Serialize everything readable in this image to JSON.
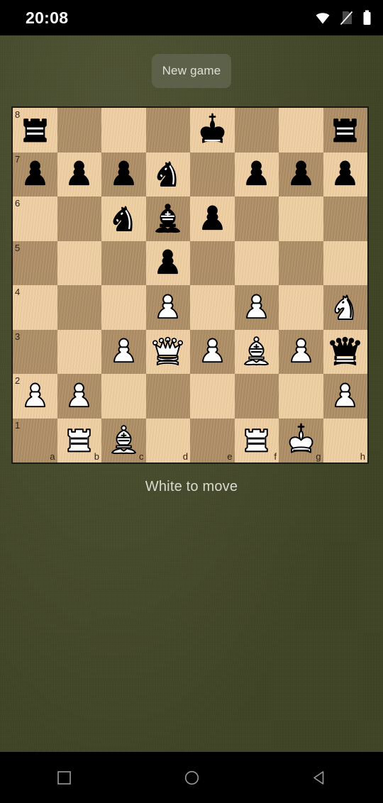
{
  "status_bar": {
    "clock": "20:08",
    "icons": [
      "wifi-icon",
      "no-sim-icon",
      "battery-icon"
    ]
  },
  "toolbar": {
    "new_game_label": "New game"
  },
  "board": {
    "files": [
      "a",
      "b",
      "c",
      "d",
      "e",
      "f",
      "g",
      "h"
    ],
    "ranks": [
      "8",
      "7",
      "6",
      "5",
      "4",
      "3",
      "2",
      "1"
    ],
    "light_square_color": "#edcda1",
    "dark_square_color": "#ab8c65",
    "orientation": "white-bottom",
    "position": [
      [
        "br",
        "",
        "",
        "",
        "bk",
        "",
        "",
        "br"
      ],
      [
        "bp",
        "bp",
        "bp",
        "bn",
        "",
        "bp",
        "bp",
        "bp"
      ],
      [
        "",
        "",
        "bn",
        "bb",
        "bp",
        "",
        "",
        ""
      ],
      [
        "",
        "",
        "",
        "bp",
        "",
        "",
        "",
        ""
      ],
      [
        "",
        "",
        "",
        "wp",
        "",
        "wp",
        "",
        "wn"
      ],
      [
        "",
        "",
        "wp",
        "wq",
        "wp",
        "wb",
        "wp",
        "bq"
      ],
      [
        "wp",
        "wp",
        "",
        "",
        "",
        "",
        "",
        "wp"
      ],
      [
        "",
        "wr",
        "wb",
        "",
        "",
        "wr",
        "wk",
        ""
      ]
    ],
    "fen": "r3k2r/pppn1ppp/2nbp3/3p4/3P1P1N/2PQPBPq/PP5P/1RB2RK1 w kq - 0 1"
  },
  "status": {
    "text": "White to move"
  },
  "nav_bar": {
    "recents_label": "recents-square-icon",
    "home_label": "home-circle-icon",
    "back_label": "back-triangle-icon"
  }
}
